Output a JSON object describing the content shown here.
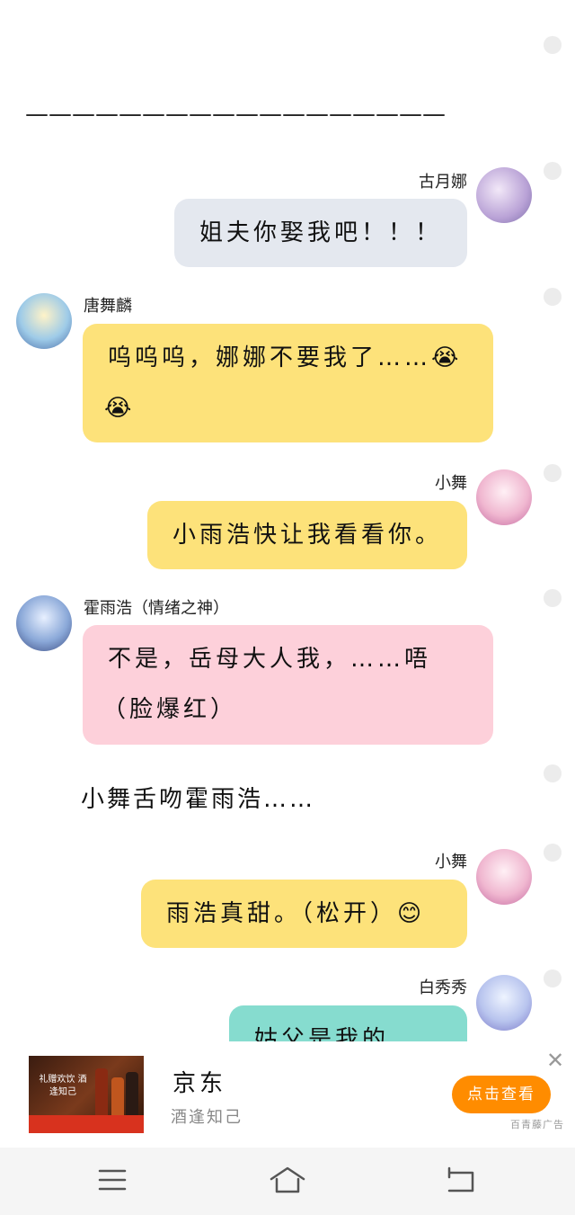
{
  "chat": {
    "divider": "——————————————————",
    "messages": [
      {
        "side": "right",
        "name": "古月娜",
        "text": "姐夫你娶我吧！！！",
        "color": "#e4e8ef"
      },
      {
        "side": "left",
        "name": "唐舞麟",
        "line1": "呜呜呜，娜娜不要我了……",
        "emoji": "😭",
        "color": "#fde27a"
      },
      {
        "side": "right",
        "name": "小舞",
        "text": "小雨浩快让我看看你。",
        "color": "#fde27a"
      },
      {
        "side": "left",
        "name": "霍雨浩（情绪之神）",
        "line1": "不是，岳母大人我，……唔",
        "line2": "（脸爆红）",
        "color": "#fdd0da"
      },
      {
        "narration": "小舞舌吻霍雨浩……"
      },
      {
        "side": "right",
        "name": "小舞",
        "text": "雨浩真甜。（松开）",
        "emoji": "😊",
        "color": "#fde27a"
      },
      {
        "side": "right",
        "name": "白秀秀",
        "text": "姑父是我的啦！",
        "color": "#86dccf"
      }
    ]
  },
  "ad": {
    "image_text": "礼赠欢饮 酒逢知己",
    "title": "京东",
    "subtitle": "酒逢知己",
    "button": "点击查看",
    "close": "✕",
    "tag": "百青藤广告"
  },
  "nav": {
    "menu": "menu-icon",
    "home": "home-icon",
    "back": "back-icon"
  }
}
